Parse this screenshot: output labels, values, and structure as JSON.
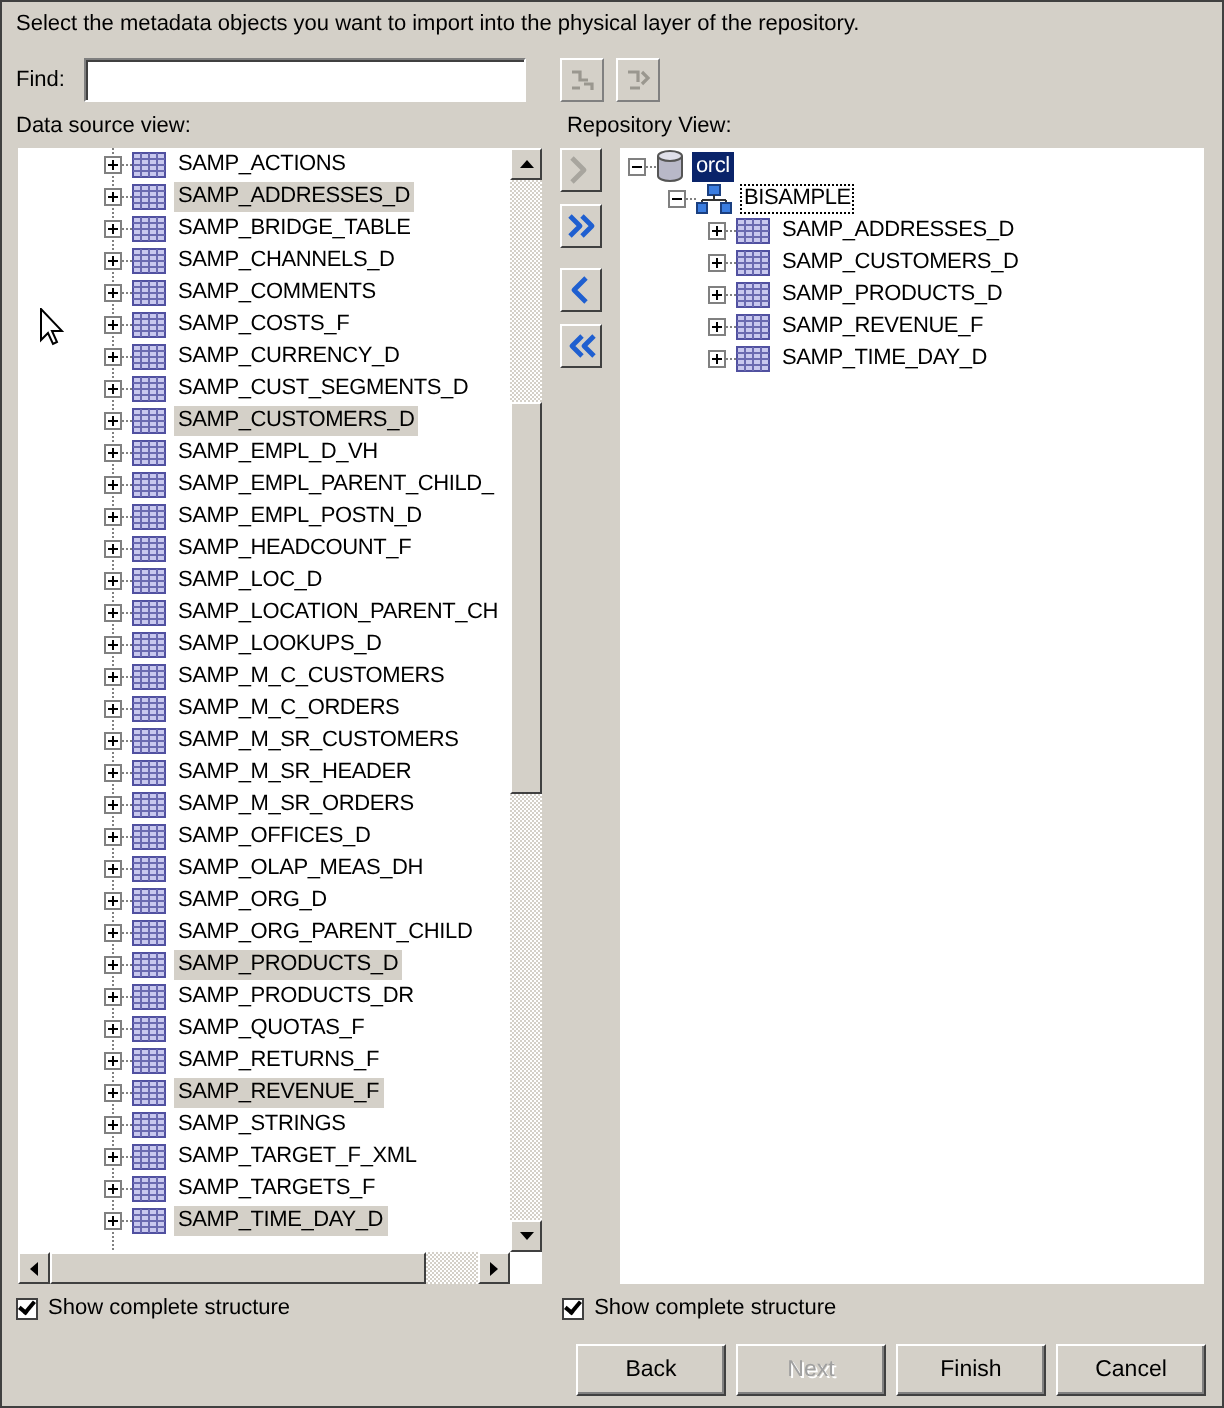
{
  "instruction": "Select the metadata objects you want to import into the physical layer of the repository.",
  "find": {
    "label": "Find:"
  },
  "find_buttons": [
    {
      "kind": "find",
      "disabled": true
    },
    {
      "kind": "find-again",
      "disabled": true
    }
  ],
  "data_source": {
    "label": "Data source view:",
    "items": [
      {
        "name": "SAMP_ACTIONS",
        "selected": false
      },
      {
        "name": "SAMP_ADDRESSES_D",
        "selected": true
      },
      {
        "name": "SAMP_BRIDGE_TABLE",
        "selected": false
      },
      {
        "name": "SAMP_CHANNELS_D",
        "selected": false
      },
      {
        "name": "SAMP_COMMENTS",
        "selected": false
      },
      {
        "name": "SAMP_COSTS_F",
        "selected": false
      },
      {
        "name": "SAMP_CURRENCY_D",
        "selected": false
      },
      {
        "name": "SAMP_CUST_SEGMENTS_D",
        "selected": false
      },
      {
        "name": "SAMP_CUSTOMERS_D",
        "selected": true
      },
      {
        "name": "SAMP_EMPL_D_VH",
        "selected": false
      },
      {
        "name": "SAMP_EMPL_PARENT_CHILD_",
        "selected": false
      },
      {
        "name": "SAMP_EMPL_POSTN_D",
        "selected": false
      },
      {
        "name": "SAMP_HEADCOUNT_F",
        "selected": false
      },
      {
        "name": "SAMP_LOC_D",
        "selected": false
      },
      {
        "name": "SAMP_LOCATION_PARENT_CH",
        "selected": false
      },
      {
        "name": "SAMP_LOOKUPS_D",
        "selected": false
      },
      {
        "name": "SAMP_M_C_CUSTOMERS",
        "selected": false
      },
      {
        "name": "SAMP_M_C_ORDERS",
        "selected": false
      },
      {
        "name": "SAMP_M_SR_CUSTOMERS",
        "selected": false
      },
      {
        "name": "SAMP_M_SR_HEADER",
        "selected": false
      },
      {
        "name": "SAMP_M_SR_ORDERS",
        "selected": false
      },
      {
        "name": "SAMP_OFFICES_D",
        "selected": false
      },
      {
        "name": "SAMP_OLAP_MEAS_DH",
        "selected": false
      },
      {
        "name": "SAMP_ORG_D",
        "selected": false
      },
      {
        "name": "SAMP_ORG_PARENT_CHILD",
        "selected": false
      },
      {
        "name": "SAMP_PRODUCTS_D",
        "selected": true
      },
      {
        "name": "SAMP_PRODUCTS_DR",
        "selected": false
      },
      {
        "name": "SAMP_QUOTAS_F",
        "selected": false
      },
      {
        "name": "SAMP_RETURNS_F",
        "selected": false
      },
      {
        "name": "SAMP_REVENUE_F",
        "selected": true
      },
      {
        "name": "SAMP_STRINGS",
        "selected": false
      },
      {
        "name": "SAMP_TARGET_F_XML",
        "selected": false
      },
      {
        "name": "SAMP_TARGETS_F",
        "selected": false
      },
      {
        "name": "SAMP_TIME_DAY_D",
        "selected": true
      }
    ],
    "show_complete_structure": {
      "label": "Show complete structure",
      "checked": true
    }
  },
  "move_buttons": [
    {
      "kind": "add",
      "disabled": true
    },
    {
      "kind": "add-all",
      "disabled": false
    },
    {
      "kind": "remove",
      "disabled": false
    },
    {
      "kind": "remove-all",
      "disabled": false
    }
  ],
  "repository": {
    "label": "Repository View:",
    "tree": [
      {
        "name": "orcl",
        "kind": "database",
        "selected": true,
        "expanded": true,
        "children": [
          {
            "name": "BISAMPLE",
            "kind": "schema",
            "selected": false,
            "expanded": true,
            "children": [
              {
                "name": "SAMP_ADDRESSES_D",
                "kind": "table",
                "selected": false,
                "expanded": false
              },
              {
                "name": "SAMP_CUSTOMERS_D",
                "kind": "table",
                "selected": false,
                "expanded": false
              },
              {
                "name": "SAMP_PRODUCTS_D",
                "kind": "table",
                "selected": false,
                "expanded": false
              },
              {
                "name": "SAMP_REVENUE_F",
                "kind": "table",
                "selected": false,
                "expanded": false
              },
              {
                "name": "SAMP_TIME_DAY_D",
                "kind": "table",
                "selected": false,
                "expanded": false
              }
            ]
          }
        ]
      }
    ],
    "show_complete_structure": {
      "label": "Show complete structure",
      "checked": true
    }
  },
  "buttons": [
    {
      "label": "Back",
      "disabled": false
    },
    {
      "label": "Next",
      "disabled": true
    },
    {
      "label": "Finish",
      "disabled": false
    },
    {
      "label": "Cancel",
      "disabled": false
    }
  ]
}
